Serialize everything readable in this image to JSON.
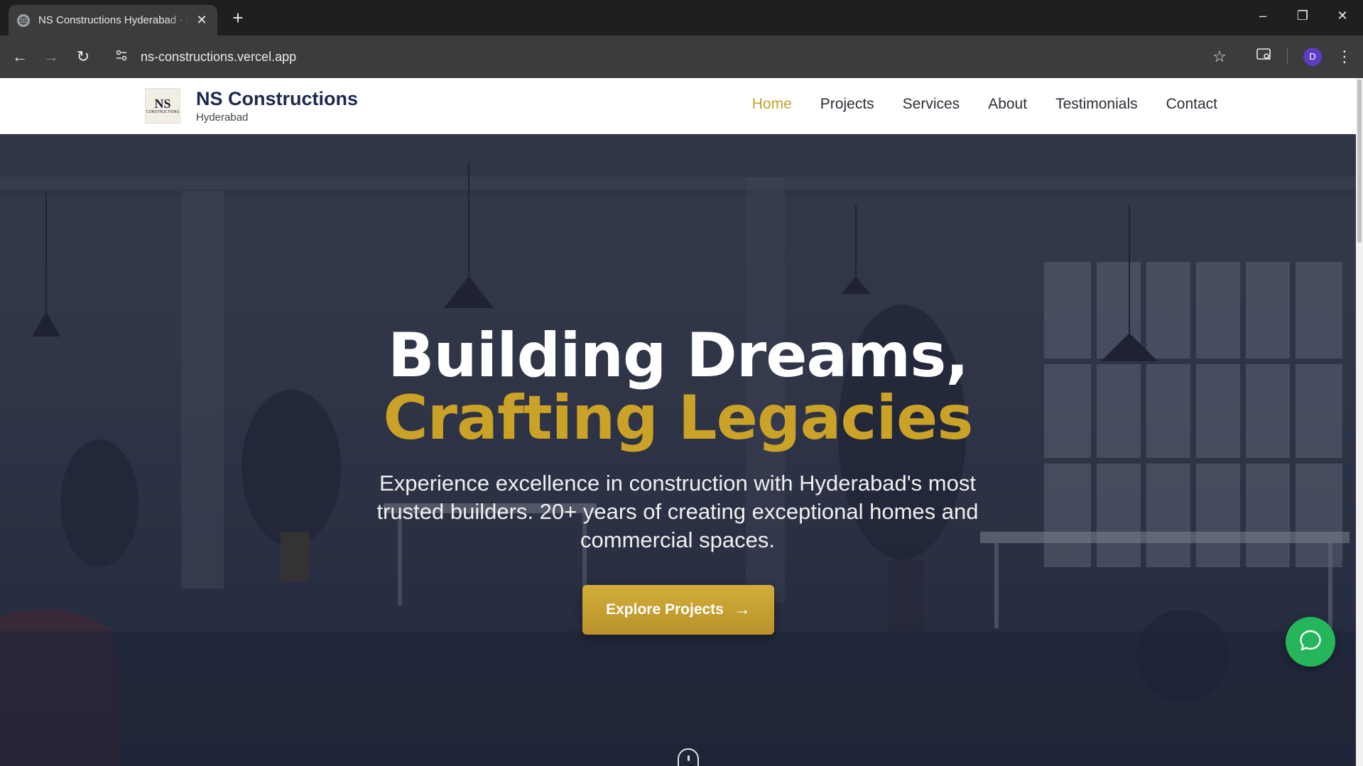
{
  "browser": {
    "tab_title": "NS Constructions Hyderabad - Building Dreams",
    "url": "ns-constructions.vercel.app",
    "profile_initial": "D"
  },
  "site": {
    "brand_name": "NS Constructions",
    "brand_city": "Hyderabad",
    "logo_text": "NS",
    "logo_subtext": "CONSTRUCTIONS",
    "nav": [
      {
        "label": "Home"
      },
      {
        "label": "Projects"
      },
      {
        "label": "Services"
      },
      {
        "label": "About"
      },
      {
        "label": "Testimonials"
      },
      {
        "label": "Contact"
      }
    ],
    "active_nav": "Home"
  },
  "hero": {
    "title_line1": "Building Dreams,",
    "title_line2": "Crafting Legacies",
    "subtitle": "Experience excellence in construction with Hyderabad's most trusted builders. 20+ years of creating exceptional homes and commercial spaces.",
    "cta_label": "Explore Projects"
  },
  "colors": {
    "accent": "#c9a227",
    "brand": "#1b2a4e",
    "chat": "#25b55a"
  },
  "icons": {
    "cta": "arrow-right-icon",
    "chat": "chat-bubble-icon"
  }
}
